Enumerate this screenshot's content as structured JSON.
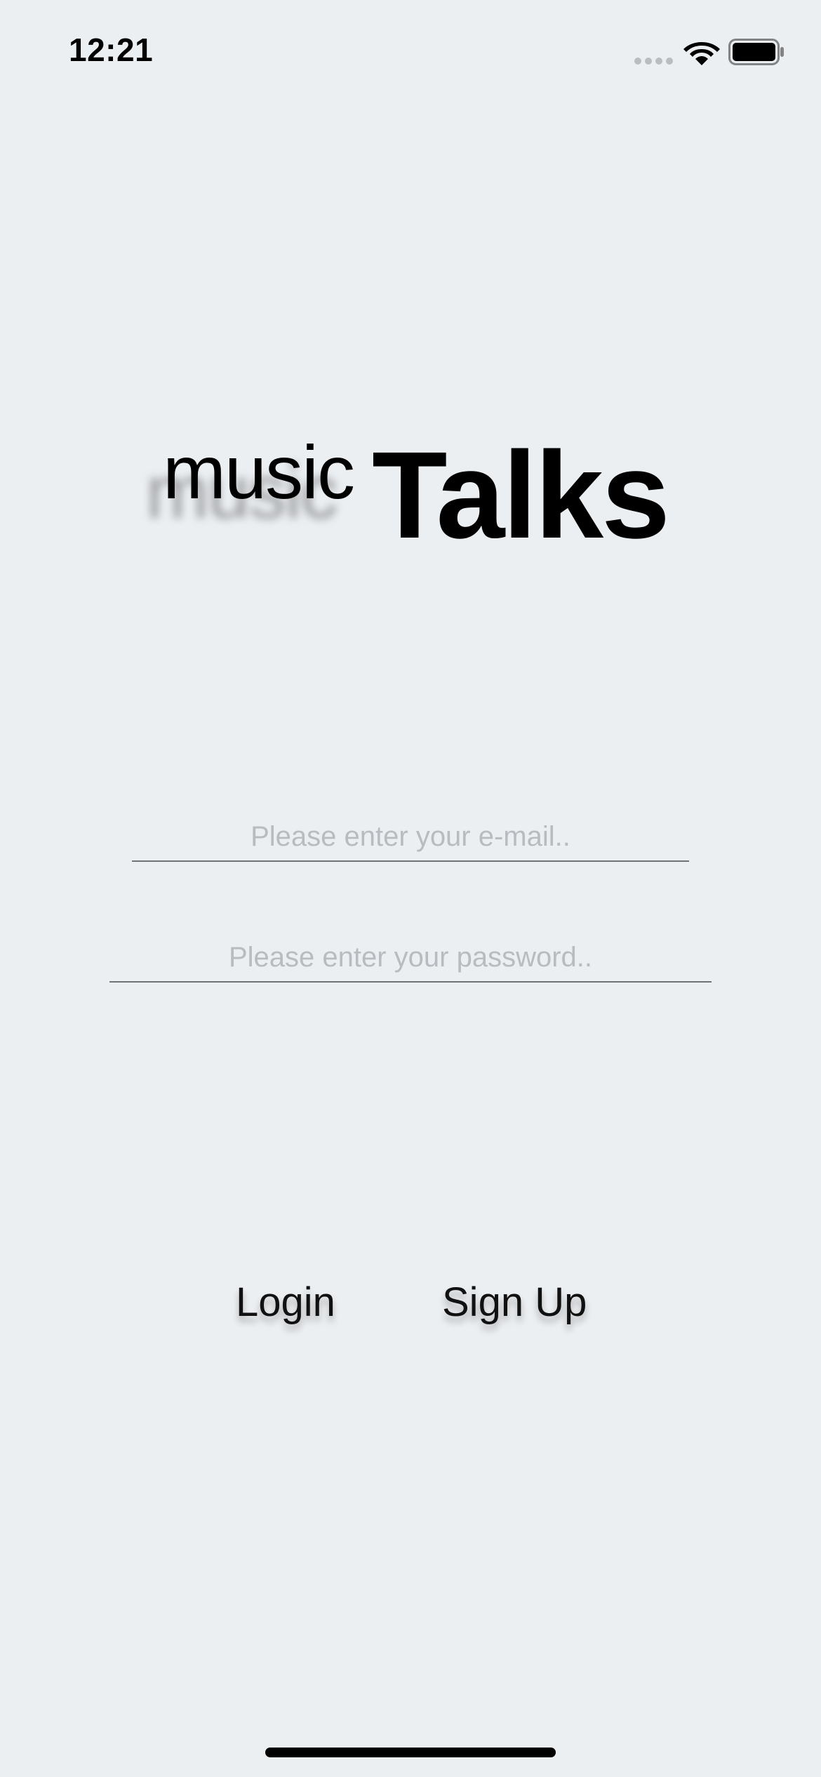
{
  "status_bar": {
    "time": "12:21",
    "icons": [
      "cellular-signal-icon",
      "wifi-icon",
      "battery-icon"
    ]
  },
  "logo": {
    "prefix": "music",
    "name": "Talks"
  },
  "form": {
    "email_placeholder": "Please enter your e-mail..",
    "email_value": "",
    "password_placeholder": "Please enter your password..",
    "password_value": ""
  },
  "actions": {
    "login_label": "Login",
    "signup_label": "Sign Up"
  },
  "colors": {
    "background": "#eceff2",
    "text": "#000000",
    "placeholder": "#b8bbbf",
    "underline": "#6f7276"
  }
}
